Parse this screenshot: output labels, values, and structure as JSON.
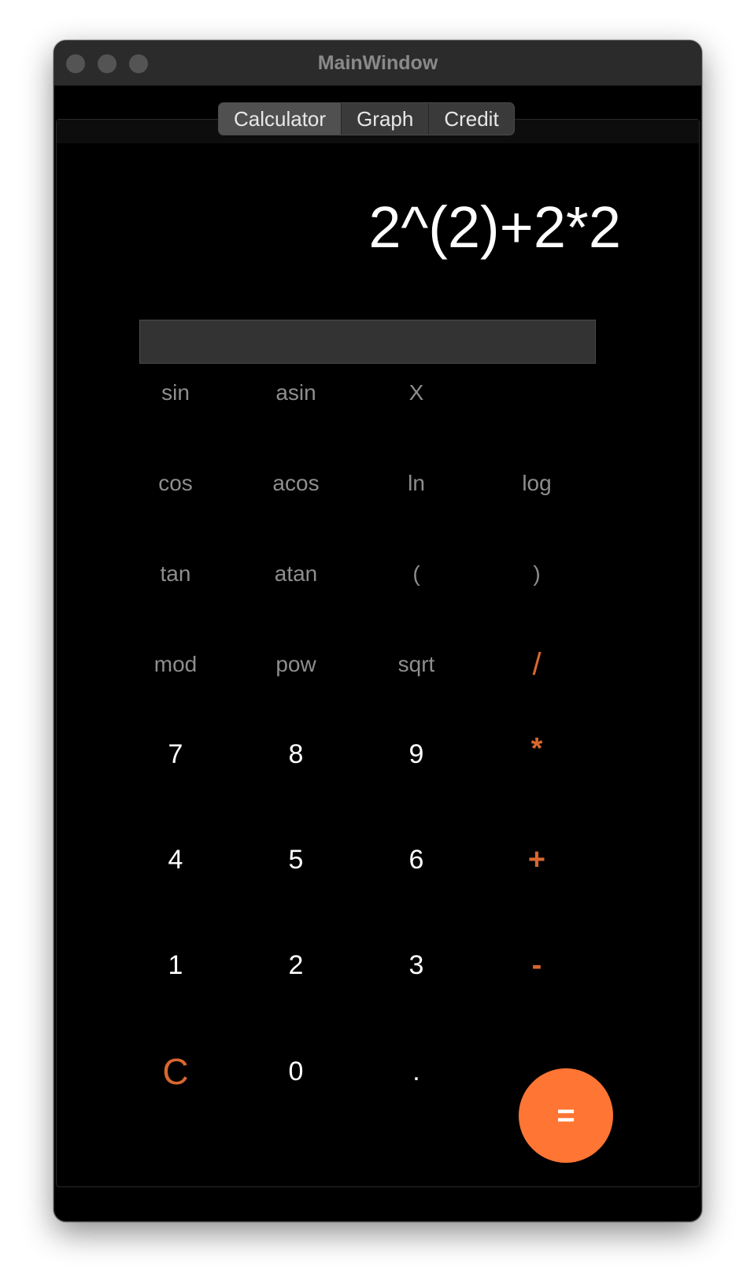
{
  "window": {
    "title": "MainWindow"
  },
  "tabs": [
    {
      "label": "Calculator"
    },
    {
      "label": "Graph"
    },
    {
      "label": "Credit"
    }
  ],
  "display": {
    "expression": "2^(2)+2*2",
    "result_value": ""
  },
  "keys": {
    "sin": "sin",
    "asin": "asin",
    "x": "X",
    "cos": "cos",
    "acos": "acos",
    "ln": "ln",
    "log": "log",
    "tan": "tan",
    "atan": "atan",
    "lparen": "(",
    "rparen": ")",
    "mod": "mod",
    "pow": "pow",
    "sqrt": "sqrt",
    "divide": "/",
    "seven": "7",
    "eight": "8",
    "nine": "9",
    "multiply": "*",
    "four": "4",
    "five": "5",
    "six": "6",
    "plus": "+",
    "one": "1",
    "two": "2",
    "three": "3",
    "minus": "-",
    "clear": "C",
    "zero": "0",
    "dot": ".",
    "equals": "="
  },
  "colors": {
    "accent": "#ff7534",
    "operator": "#d8672f",
    "function_key": "#8e8e8e",
    "background": "#000000"
  }
}
